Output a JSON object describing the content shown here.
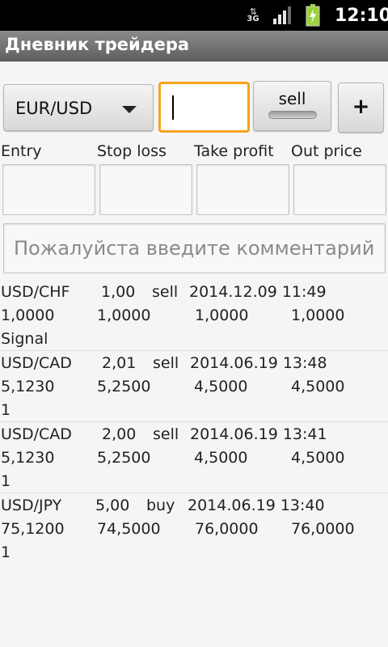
{
  "status_bar": {
    "network": "3G",
    "time": "12:10"
  },
  "app": {
    "title": "Дневник трейдера"
  },
  "form": {
    "pair": "EUR/USD",
    "volume_value": "",
    "direction_label": "sell",
    "add_label": "+",
    "labels": {
      "entry": "Entry",
      "stop_loss": "Stop loss",
      "take_profit": "Take profit",
      "out_price": "Out price"
    },
    "entry_value": "",
    "stop_loss_value": "",
    "take_profit_value": "",
    "out_price_value": "",
    "comment_placeholder": "Пожалуйста введите комментарий"
  },
  "trades": [
    {
      "pair": "USD/CHF",
      "volume": "1,00",
      "direction": "sell",
      "datetime": "2014.12.09 11:49",
      "entry": "1,0000",
      "stop_loss": "1,0000",
      "take_profit": "1,0000",
      "out_price": "1,0000",
      "comment": "Signal"
    },
    {
      "pair": "USD/CAD",
      "volume": "2,01",
      "direction": "sell",
      "datetime": "2014.06.19 13:48",
      "entry": "5,1230",
      "stop_loss": "5,2500",
      "take_profit": "4,5000",
      "out_price": "4,5000",
      "comment": "1"
    },
    {
      "pair": "USD/CAD",
      "volume": "2,00",
      "direction": "sell",
      "datetime": "2014.06.19 13:41",
      "entry": "5,1230",
      "stop_loss": "5,2500",
      "take_profit": "4,5000",
      "out_price": "4,5000",
      "comment": "1"
    },
    {
      "pair": "USD/JPY",
      "volume": "5,00",
      "direction": "buy",
      "datetime": "2014.06.19 13:40",
      "entry": "75,1200",
      "stop_loss": "74,5000",
      "take_profit": "76,0000",
      "out_price": "76,0000",
      "comment": "1"
    }
  ]
}
